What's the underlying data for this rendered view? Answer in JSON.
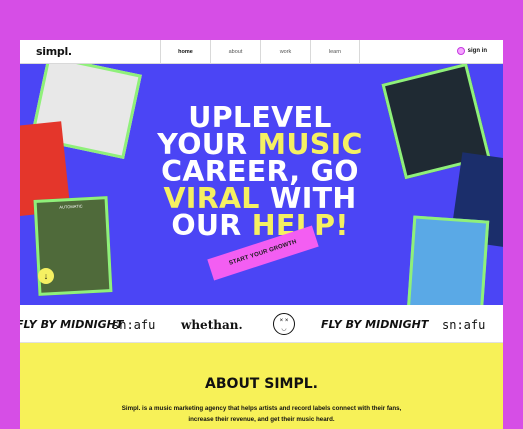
{
  "brand": {
    "logo": "simpl."
  },
  "nav": {
    "links": [
      {
        "label": "home",
        "active": true
      },
      {
        "label": "about",
        "active": false
      },
      {
        "label": "work",
        "active": false
      },
      {
        "label": "learn",
        "active": false
      }
    ],
    "signin": "sign in"
  },
  "hero": {
    "headline": {
      "w1": "UPLEVEL",
      "w2": "YOUR",
      "w3": "MUSIC",
      "w4": "CAREER, GO",
      "w5": "VIRAL",
      "w6": "WITH",
      "w7": "OUR",
      "w8": "HELP!"
    },
    "cta": "START YOUR GROWTH",
    "card_tag": "AUTOMATIC"
  },
  "brands": [
    "FLY BY MIDNIGHT",
    "sn:afu",
    "whethan.",
    "FLY BY MIDNIGHT",
    "sn:afu"
  ],
  "about": {
    "title": "ABOUT SIMPL.",
    "text": "Simpl. is a music marketing agency that helps artists and record labels connect with their fans, increase their revenue, and get their music heard."
  },
  "colors": {
    "background": "#d64ee6",
    "hero": "#4b45f5",
    "highlight": "#f5f062",
    "cta": "#f35ef2",
    "card_border": "#8ff07a",
    "about_bg": "#f7f158"
  },
  "icons": [
    "user-icon",
    "arrow-down-icon",
    "smiley-logo-icon"
  ]
}
